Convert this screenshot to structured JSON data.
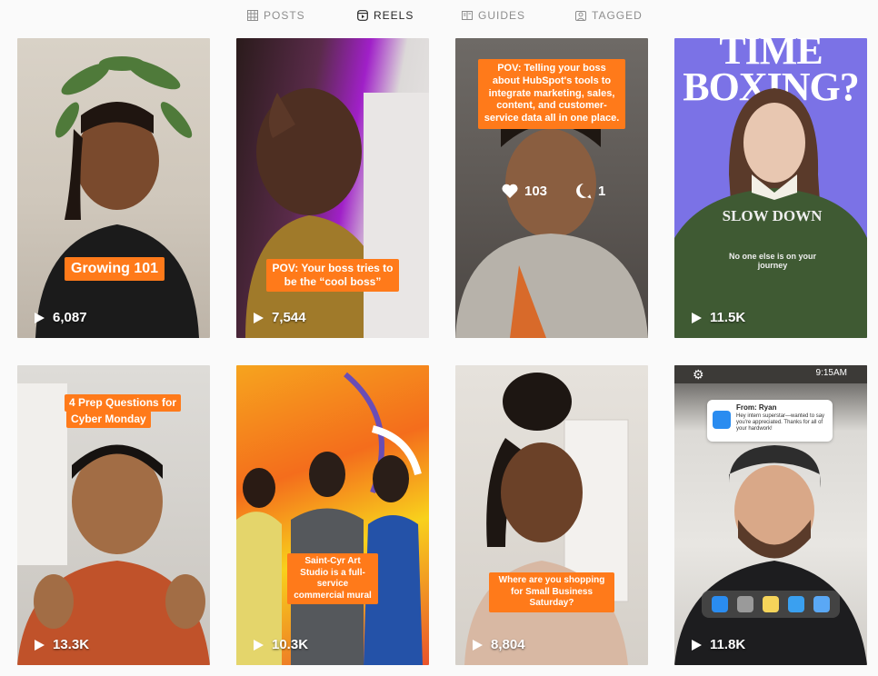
{
  "tabs": [
    {
      "label": "POSTS",
      "icon": "grid-icon",
      "active": false
    },
    {
      "label": "REELS",
      "icon": "reels-icon",
      "active": true
    },
    {
      "label": "GUIDES",
      "icon": "guide-icon",
      "active": false
    },
    {
      "label": "TAGGED",
      "icon": "tag-icon",
      "active": false
    }
  ],
  "reels": [
    {
      "caption": "Growing 101",
      "views": "6,087"
    },
    {
      "caption": "POV: Your boss tries to be the “cool boss”",
      "views": "7,544"
    },
    {
      "caption": "POV: Telling your boss about HubSpot's tools to integrate marketing, sales, content, and customer-service data all in one place.",
      "views": "",
      "likes": "103",
      "comments": "1"
    },
    {
      "caption": "TIME BOXING?",
      "shirt_text": "SLOW DOWN",
      "shirt_sub": "No one else is on your journey",
      "views": "11.5K"
    },
    {
      "caption_line1": "4 Prep Questions for",
      "caption_line2": "Cyber Monday",
      "views": "13.3K"
    },
    {
      "caption": "Saint-Cyr Art Studio is a full-service commercial mural",
      "views": "10.3K"
    },
    {
      "caption": "Where are you shopping for Small Business Saturday?",
      "views": "8,804"
    },
    {
      "time": "9:15AM",
      "notif_from": "From: Ryan",
      "notif_body": "Hey intern superstar—wanted to say you're appreciated. Thanks for all of your hardwork!",
      "views": "11.8K"
    }
  ],
  "colors": {
    "accent_orange": "#ff7a1a",
    "text_active": "#262626",
    "text_inactive": "#8e8e8e"
  }
}
